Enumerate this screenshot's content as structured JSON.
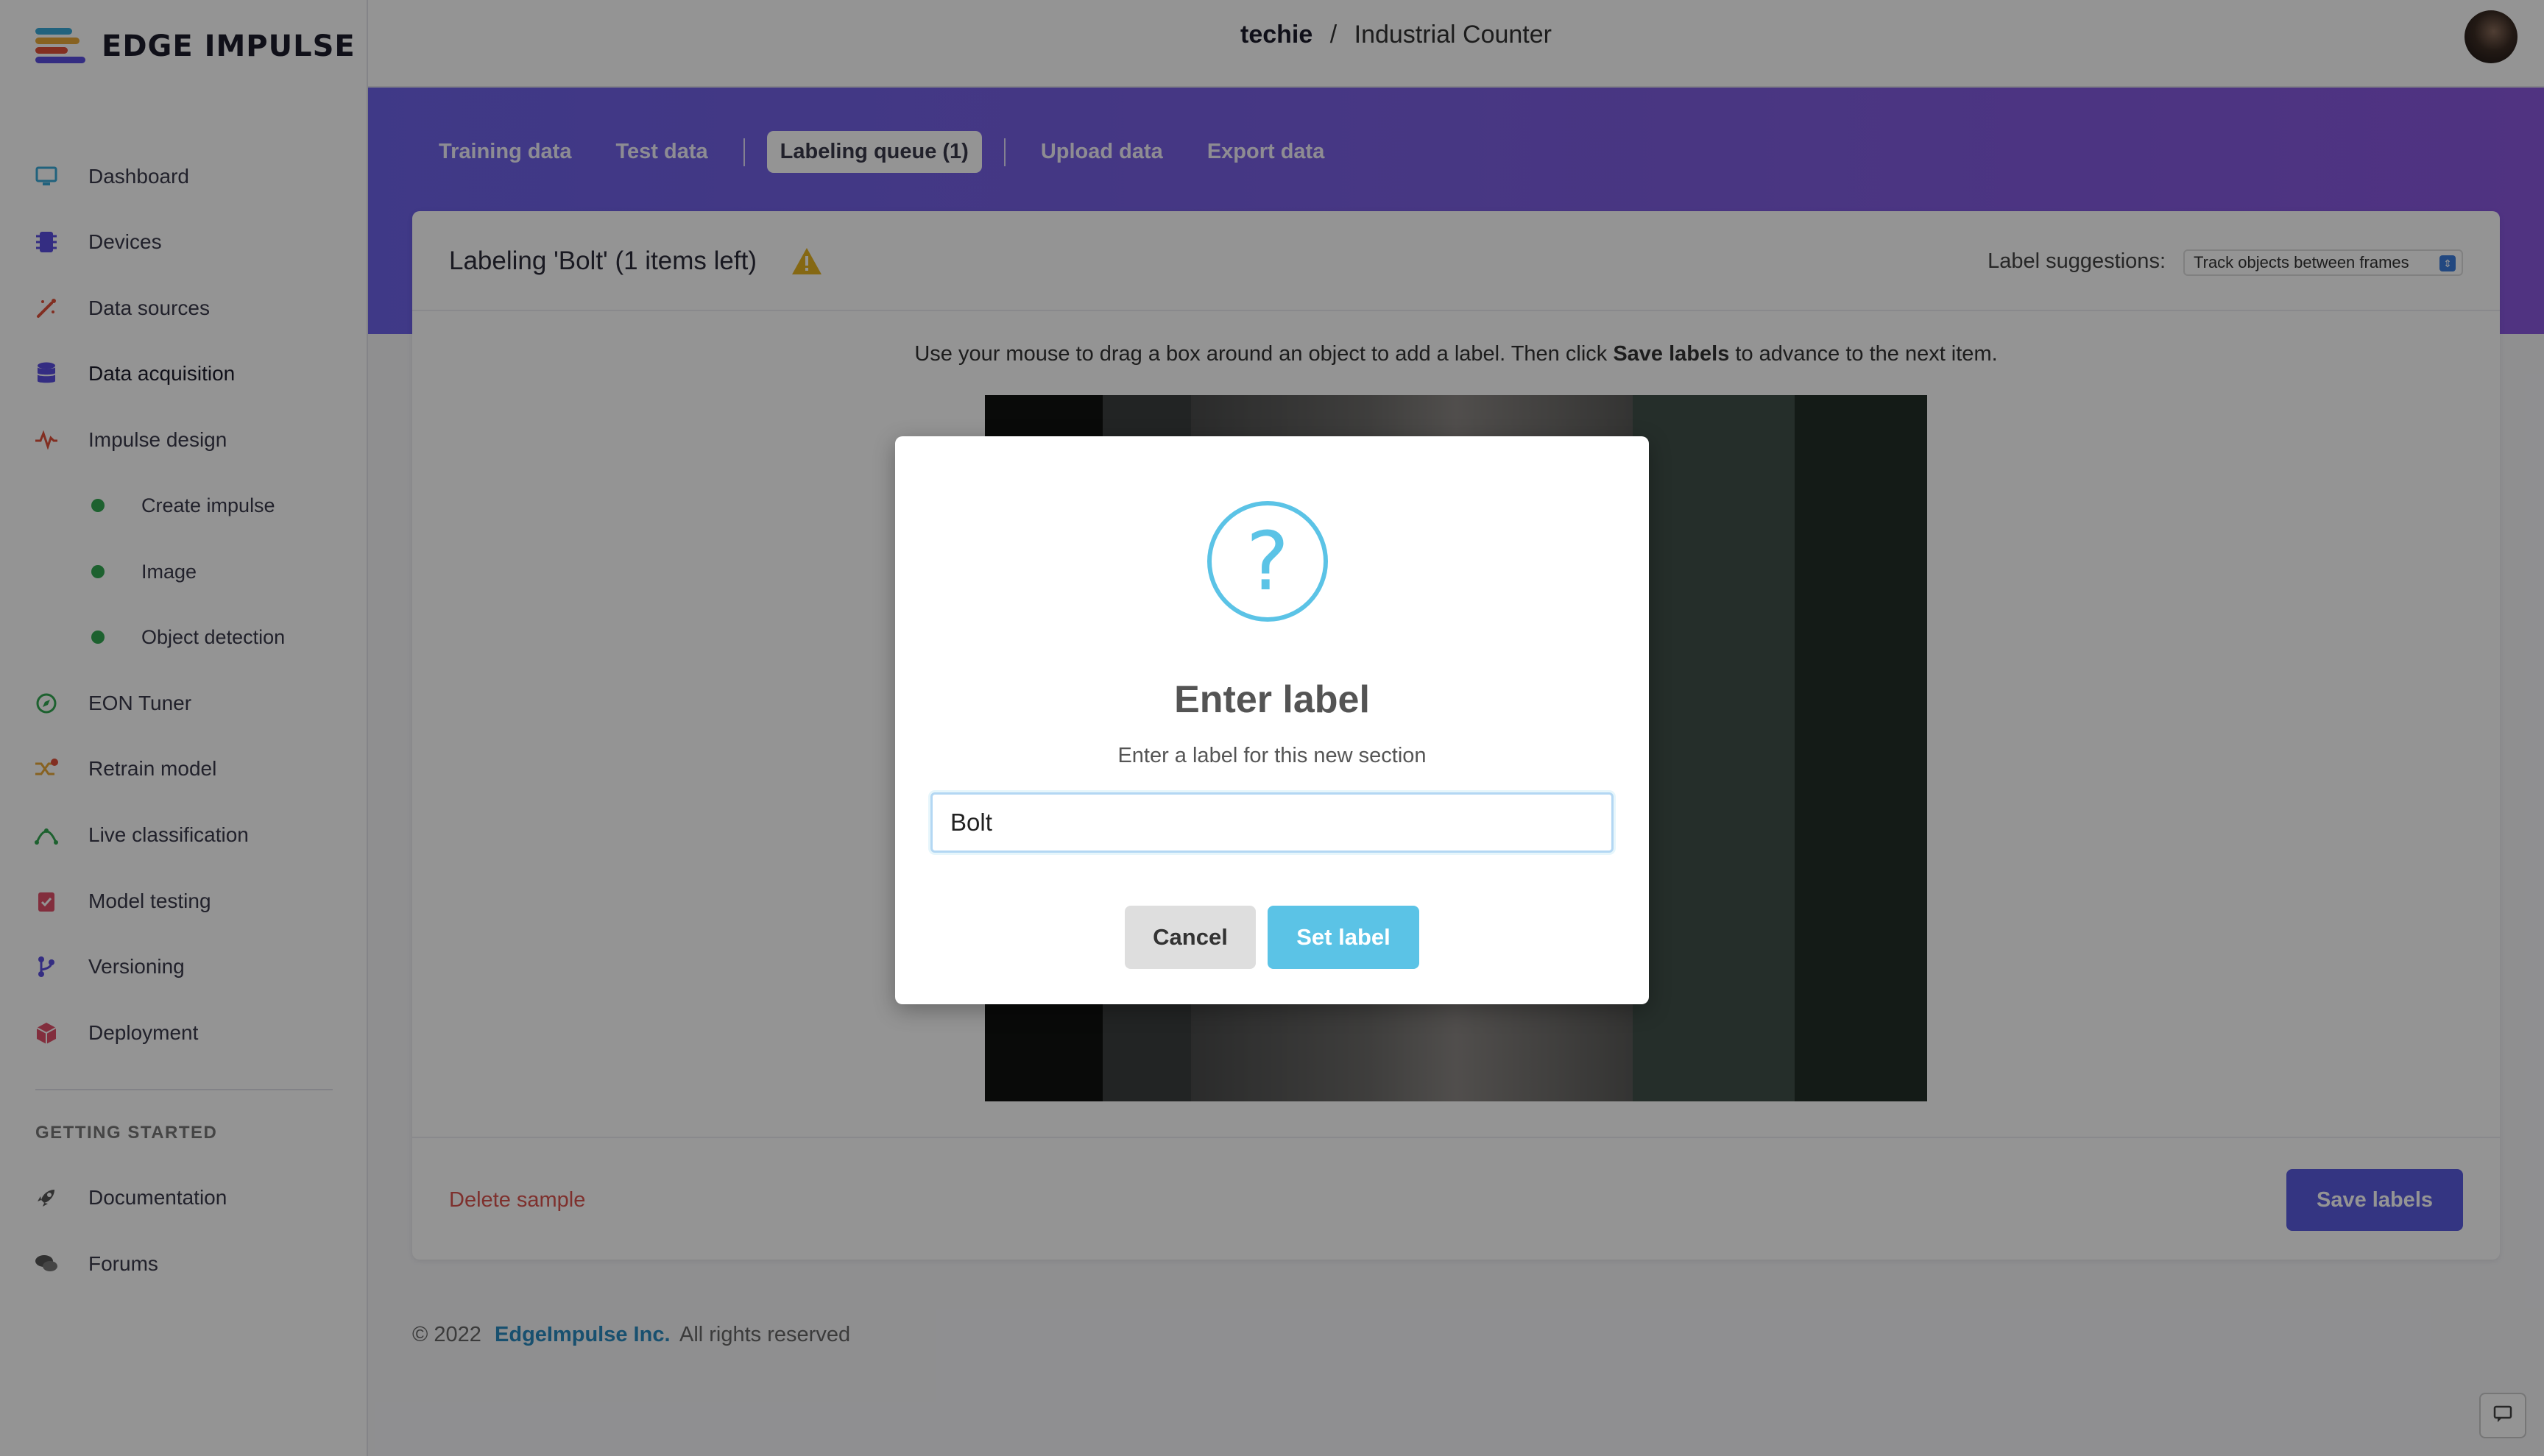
{
  "app": {
    "brand": "EDGE IMPULSE",
    "breadcrumb_user": "techie",
    "breadcrumb_sep": "/",
    "breadcrumb_project": "Industrial Counter"
  },
  "sidebar": {
    "items": [
      {
        "label": "Dashboard",
        "icon": "monitor-icon"
      },
      {
        "label": "Devices",
        "icon": "chip-icon"
      },
      {
        "label": "Data sources",
        "icon": "wand-icon"
      },
      {
        "label": "Data acquisition",
        "icon": "database-icon"
      },
      {
        "label": "Impulse design",
        "icon": "pulse-icon"
      },
      {
        "label": "Create impulse",
        "icon": "dot"
      },
      {
        "label": "Image",
        "icon": "dot"
      },
      {
        "label": "Object detection",
        "icon": "dot"
      },
      {
        "label": "EON Tuner",
        "icon": "compass-icon"
      },
      {
        "label": "Retrain model",
        "icon": "shuffle-icon"
      },
      {
        "label": "Live classification",
        "icon": "curve-icon"
      },
      {
        "label": "Model testing",
        "icon": "clipboard-check-icon"
      },
      {
        "label": "Versioning",
        "icon": "branch-icon"
      },
      {
        "label": "Deployment",
        "icon": "cube-icon"
      }
    ],
    "getting_started_label": "GETTING STARTED",
    "help_items": [
      {
        "label": "Documentation",
        "icon": "rocket-icon"
      },
      {
        "label": "Forums",
        "icon": "chat-bubbles-icon"
      }
    ]
  },
  "tabs": {
    "training": "Training data",
    "test": "Test data",
    "queue": "Labeling queue (1)",
    "upload": "Upload data",
    "export": "Export data"
  },
  "card": {
    "title": "Labeling 'Bolt' (1 items left)",
    "suggestions_label": "Label suggestions:",
    "suggestions_value": "Track objects between frames",
    "instruction_pre": "Use your mouse to drag a box around an object to add a label. Then click ",
    "instruction_bold": "Save labels",
    "instruction_post": " to advance to the next item.",
    "delete_label": "Delete sample",
    "save_label": "Save labels"
  },
  "footer": {
    "copyright": "© 2022",
    "company": "EdgeImpulse Inc.",
    "rights": "All rights reserved"
  },
  "modal": {
    "icon": "question-icon",
    "title": "Enter label",
    "subtitle": "Enter a label for this new section",
    "input_value": "Bolt",
    "cancel_label": "Cancel",
    "confirm_label": "Set label"
  },
  "colors": {
    "accent": "#5b5ce0",
    "hero_start": "#6d62e8",
    "hero_end": "#8a58df",
    "modal_accent": "#5bc3e6",
    "danger": "#d9534f",
    "status_dot": "#32a852"
  }
}
